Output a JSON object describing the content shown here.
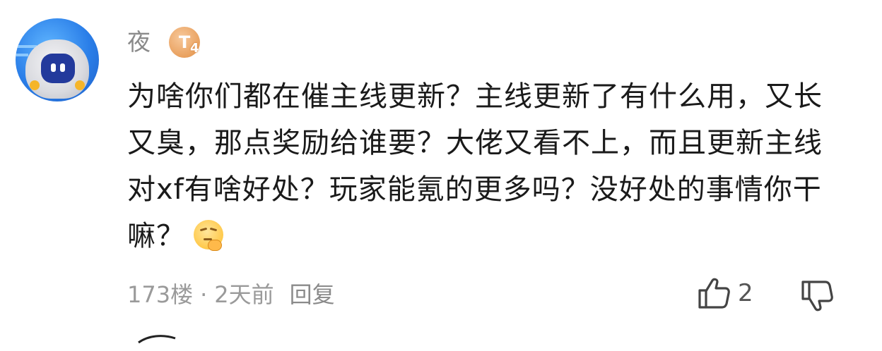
{
  "comment": {
    "username": "夜",
    "level_badge": {
      "letter": "T",
      "sub": "4"
    },
    "text": "为啥你们都在催主线更新？主线更新了有什么用，又长又臭，那点奖励给谁要？大佬又看不上，而且更新主线对xf有啥好处？玩家能氪的更多吗？没好处的事情你干嘛？",
    "emoji_icon": "thinking-face-icon",
    "floor": "173楼",
    "separator": "·",
    "time": "2天前",
    "reply_label": "回复",
    "like_count": "2",
    "icons": {
      "like": "thumbs-up-icon",
      "dislike": "thumbs-down-icon"
    }
  },
  "colors": {
    "username": "#8a8a8a",
    "text": "#1a1a1a",
    "meta": "#9a9a9a",
    "badge": "#e9a15f"
  }
}
